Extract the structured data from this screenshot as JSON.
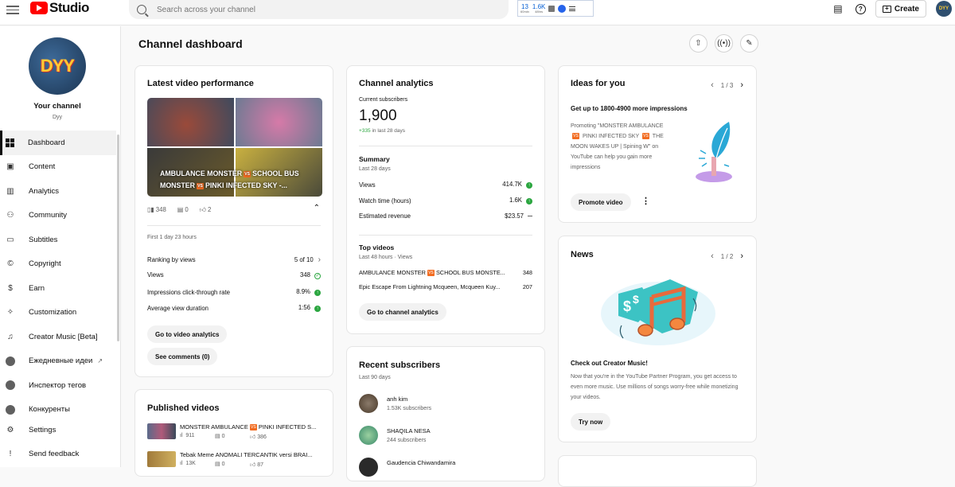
{
  "app": {
    "logo_text": "Studio"
  },
  "search": {
    "placeholder": "Search across your channel"
  },
  "extension": {
    "stat1": "13",
    "stat1_sub": "60min",
    "stat2": "1.6K",
    "stat2_sub": "48hrs"
  },
  "topbar": {
    "create_label": "Create",
    "avatar_text": "DYY"
  },
  "sidebar": {
    "channel_label": "Your channel",
    "channel_handle": "Dyy",
    "avatar_text": "DYY",
    "items": [
      {
        "label": "Dashboard"
      },
      {
        "label": "Content"
      },
      {
        "label": "Analytics"
      },
      {
        "label": "Community"
      },
      {
        "label": "Subtitles"
      },
      {
        "label": "Copyright"
      },
      {
        "label": "Earn"
      },
      {
        "label": "Customization"
      },
      {
        "label": "Creator Music [Beta]"
      },
      {
        "label": "Ежедневные идеи"
      },
      {
        "label": "Инспектор тегов"
      },
      {
        "label": "Конкуренты"
      }
    ],
    "bottom_items": [
      {
        "label": "Settings"
      },
      {
        "label": "Send feedback"
      }
    ]
  },
  "page": {
    "title": "Channel dashboard"
  },
  "latest_video": {
    "title": "Latest video performance",
    "thumb_text_1": "AMBULANCE MONSTER",
    "thumb_text_2": "SCHOOL BUS",
    "thumb_text_3": "MONSTER",
    "thumb_text_4": "PINKI INFECTED SKY -...",
    "vs": "VS",
    "views": "348",
    "comments": "0",
    "likes": "2",
    "period": "First 1 day 23 hours",
    "rows": [
      {
        "label": "Ranking by views",
        "value": "5 of 10"
      },
      {
        "label": "Views",
        "value": "348"
      },
      {
        "label": "Impressions click-through rate",
        "value": "8.9%"
      },
      {
        "label": "Average view duration",
        "value": "1:56"
      }
    ],
    "btn_analytics": "Go to video analytics",
    "btn_comments": "See comments (0)"
  },
  "channel_analytics": {
    "title": "Channel analytics",
    "subs_label": "Current subscribers",
    "subs_value": "1,900",
    "subs_change": "+335",
    "subs_change_period": "in last 28 days",
    "summary_title": "Summary",
    "summary_period": "Last 28 days",
    "summary_rows": [
      {
        "label": "Views",
        "value": "414.7K"
      },
      {
        "label": "Watch time (hours)",
        "value": "1.6K"
      },
      {
        "label": "Estimated revenue",
        "value": "$23.57"
      }
    ],
    "top_title": "Top videos",
    "top_period": "Last 48 hours · Views",
    "top_videos": [
      {
        "title_a": "AMBULANCE MONSTER",
        "title_b": "SCHOOL BUS MONSTE...",
        "views": "348"
      },
      {
        "title": "Epic Escape From Lightning Mcqueen, Mcqueen Kuy...",
        "views": "207"
      }
    ],
    "btn": "Go to channel analytics"
  },
  "recent_subs": {
    "title": "Recent subscribers",
    "period": "Last 90 days",
    "subs": [
      {
        "name": "anh kim",
        "count": "1.53K subscribers"
      },
      {
        "name": "SHAQILA NESA",
        "count": "244 subscribers"
      },
      {
        "name": "Gaudencia Chiwandamira"
      }
    ]
  },
  "published": {
    "title": "Published videos",
    "videos": [
      {
        "title_a": "MONSTER AMBULANCE",
        "title_b": "PINKI INFECTED S...",
        "views": "911",
        "comments": "0",
        "likes": "386"
      },
      {
        "title": "Tebak Meme ANOMALI TERCANTIK versi BRAI...",
        "views": "13K",
        "comments": "0",
        "likes": "87"
      }
    ]
  },
  "ideas": {
    "title": "Ideas for you",
    "pager": "1 / 3",
    "headline": "Get up to 1800-4900 more impressions",
    "body_1": "Promoting \"MONSTER AMBULANCE",
    "body_2": "PINKI INFECTED SKY",
    "body_3": "THE MOON WAKES UP | Spining W\" on YouTube can help you gain more impressions",
    "btn": "Promote video"
  },
  "news": {
    "title": "News",
    "pager": "1 / 2",
    "headline": "Check out Creator Music!",
    "body": "Now that you're in the YouTube Partner Program, you get access to even more music. Use millions of songs worry-free while monetizing your videos.",
    "btn": "Try now"
  },
  "colors": {
    "accent": "#ff0000",
    "success": "#2ba640"
  }
}
